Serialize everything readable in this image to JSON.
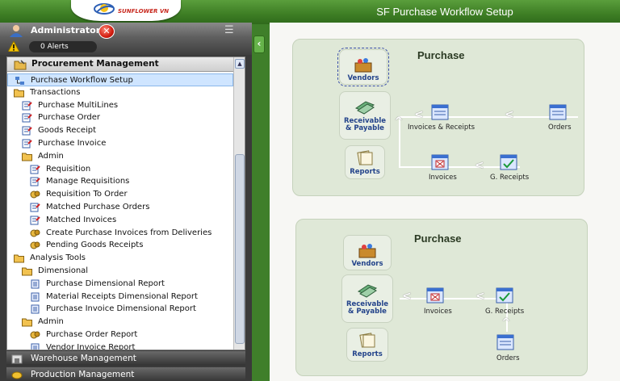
{
  "app": {
    "title": "SF Purchase Workflow Setup",
    "logo_text": "SUNFLOWER VN"
  },
  "user": {
    "name": "Administrator",
    "alerts": "0 Alerts"
  },
  "tree": {
    "header": "Procurement Management",
    "items": [
      {
        "label": "Purchase Workflow Setup",
        "icon": "workflow-icon",
        "level": 0,
        "selected": true
      },
      {
        "label": "Transactions",
        "icon": "folder-icon",
        "level": 0
      },
      {
        "label": "Purchase MultiLines",
        "icon": "form-icon",
        "level": 1
      },
      {
        "label": "Purchase Order",
        "icon": "form-icon",
        "level": 1
      },
      {
        "label": "Goods Receipt",
        "icon": "form-icon",
        "level": 1
      },
      {
        "label": "Purchase Invoice",
        "icon": "form-icon",
        "level": 1
      },
      {
        "label": "Admin",
        "icon": "folder-icon",
        "level": 1
      },
      {
        "label": "Requisition",
        "icon": "form-icon",
        "level": 2
      },
      {
        "label": "Manage Requisitions",
        "icon": "form-icon",
        "level": 2
      },
      {
        "label": "Requisition To Order",
        "icon": "process-icon",
        "level": 2
      },
      {
        "label": "Matched Purchase Orders",
        "icon": "form-icon",
        "level": 2
      },
      {
        "label": "Matched Invoices",
        "icon": "form-icon",
        "level": 2
      },
      {
        "label": "Create Purchase Invoices from Deliveries",
        "icon": "process-icon",
        "level": 2
      },
      {
        "label": "Pending Goods Receipts",
        "icon": "process-icon",
        "level": 2
      },
      {
        "label": "Analysis Tools",
        "icon": "folder-icon",
        "level": 0
      },
      {
        "label": "Dimensional",
        "icon": "folder-icon",
        "level": 1
      },
      {
        "label": "Purchase Dimensional Report",
        "icon": "report-icon",
        "level": 2
      },
      {
        "label": "Material Receipts Dimensional Report",
        "icon": "report-icon",
        "level": 2
      },
      {
        "label": "Purchase Invoice Dimensional Report",
        "icon": "report-icon",
        "level": 2
      },
      {
        "label": "Admin",
        "icon": "folder-icon",
        "level": 1
      },
      {
        "label": "Purchase Order Report",
        "icon": "process-icon",
        "level": 2
      },
      {
        "label": "Vendor Invoice Report",
        "icon": "report-icon",
        "level": 2
      }
    ]
  },
  "modules": [
    "Warehouse Management",
    "Production Management"
  ],
  "workflow1": {
    "title": "Purchase",
    "vendors": "Vendors",
    "rp_line1": "Receivable",
    "rp_line2": "& Payable",
    "reports": "Reports",
    "invoices_receipts": "Invoices & Receipts",
    "orders": "Orders",
    "invoices": "Invoices",
    "g_receipts": "G. Receipts"
  },
  "workflow2": {
    "title": "Purchase",
    "vendors": "Vendors",
    "rp_line1": "Receivable",
    "rp_line2": "& Payable",
    "reports": "Reports",
    "invoices": "Invoices",
    "g_receipts": "G. Receipts",
    "orders": "Orders"
  }
}
